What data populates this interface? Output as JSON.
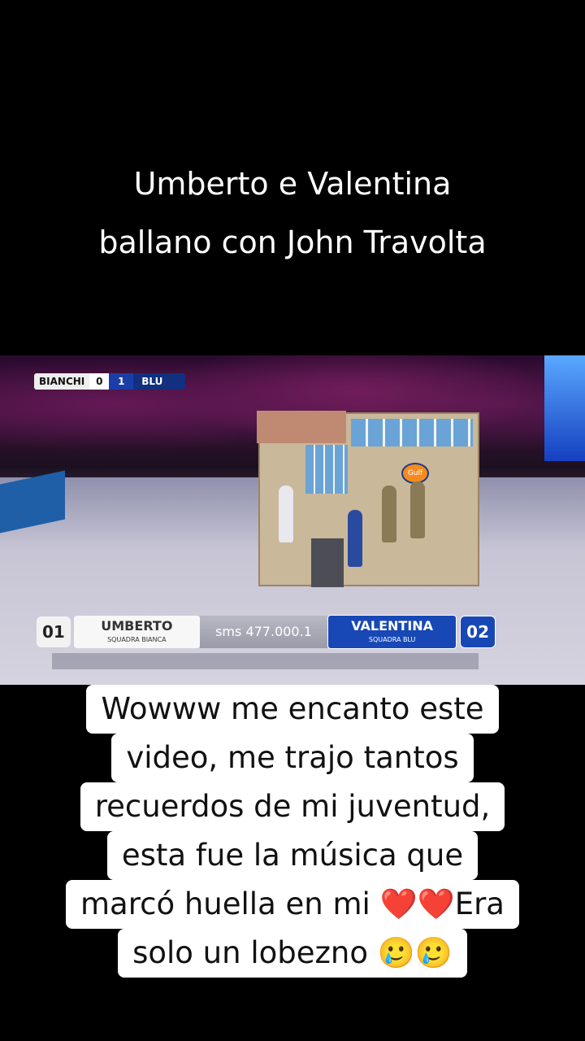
{
  "title": {
    "line1": "Umberto e Valentina",
    "line2": "ballano con John Travolta"
  },
  "video": {
    "scorebug": {
      "team_left": "BIANCHI",
      "score_left": "0",
      "score_right": "1",
      "team_right": "BLU"
    },
    "set_sign": "Gulf",
    "contestant_left": {
      "number": "01",
      "name": "UMBERTO",
      "team": "SQUADRA BIANCA"
    },
    "sms": "sms 477.000.1",
    "contestant_right": {
      "name": "VALENTINA",
      "team": "SQUADRA BLU",
      "number": "02"
    }
  },
  "caption": {
    "line1": "Wowww me encanto este",
    "line2": "video, me trajo tantos",
    "line3": "recuerdos de mi juventud,",
    "line4": "esta fue la música que",
    "line5_text": "marcó huella en mi ",
    "line5_emoji": "❤️❤️",
    "line5_end": "Era",
    "line6_text": "solo un lobezno ",
    "line6_emoji": "🥲🥲"
  }
}
